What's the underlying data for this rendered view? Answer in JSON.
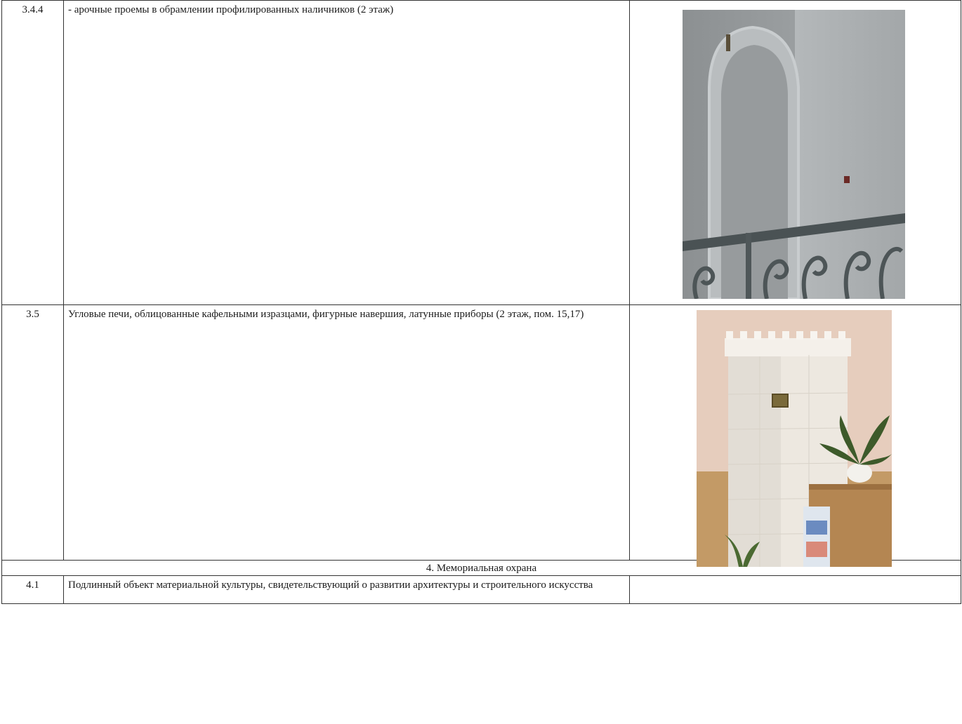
{
  "rows": [
    {
      "num": "3.4.4",
      "text": "- арочные проемы в обрамлении профилированных наличников (2 этаж)",
      "photo_icon": "arched-doorway-photo"
    },
    {
      "num": "3.5",
      "text": "Угловые печи, облицованные кафельными изразцами, фигурные навершия, латунные приборы (2 этаж, пом. 15,17)",
      "photo_icon": "tiled-corner-stove-photo"
    }
  ],
  "section": {
    "title": "4. Мемориальная охрана"
  },
  "last_row": {
    "num": "4.1",
    "text": "Подлинный объект материальной культуры, свидетельствующий о развитии архитектуры и строительного искусства"
  }
}
